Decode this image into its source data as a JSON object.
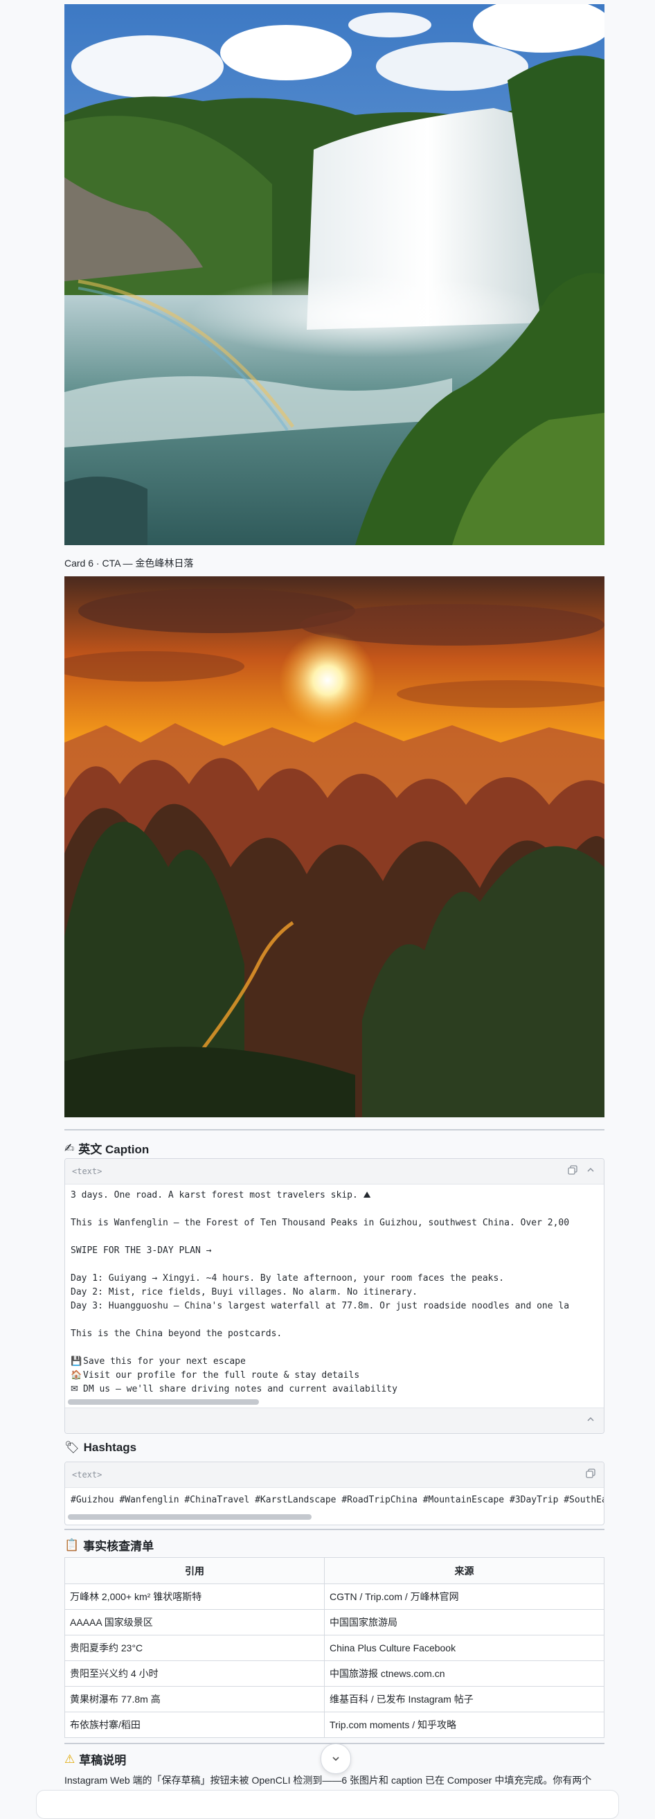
{
  "image_caption": "Card 6 · CTA — 金色峰林日落",
  "caption_section": {
    "icon": "writing-hand-icon",
    "title": "英文 Caption",
    "lang": "<text>",
    "lines": [
      {
        "icon": "",
        "text": "3 days. One road. A karst forest most travelers skip. ⛰"
      },
      {
        "icon": "",
        "text": ""
      },
      {
        "icon": "",
        "text": "This is Wanfenglin — the Forest of Ten Thousand Peaks in Guizhou, southwest China. Over 2,00"
      },
      {
        "icon": "",
        "text": ""
      },
      {
        "icon": "",
        "text": "SWIPE FOR THE 3-DAY PLAN →"
      },
      {
        "icon": "",
        "text": ""
      },
      {
        "icon": "",
        "text": "Day 1: Guiyang → Xingyi. ~4 hours. By late afternoon, your room faces the peaks."
      },
      {
        "icon": "",
        "text": "Day 2: Mist, rice fields, Buyi villages. No alarm. No itinerary."
      },
      {
        "icon": "",
        "text": "Day 3: Huangguoshu — China's largest waterfall at 77.8m. Or just roadside noodles and one la"
      },
      {
        "icon": "",
        "text": ""
      },
      {
        "icon": "",
        "text": "This is the China beyond the postcards."
      },
      {
        "icon": "",
        "text": ""
      },
      {
        "icon": "💾",
        "text": "Save this for your next escape"
      },
      {
        "icon": "🏠",
        "text": "Visit our profile for the full route & stay details"
      },
      {
        "icon": "✉",
        "text": "DM us — we'll share driving notes and current availability"
      }
    ]
  },
  "hashtags_section": {
    "icon": "label-tag-icon",
    "title": "Hashtags",
    "lang": "<text>",
    "text": "#Guizhou #Wanfenglin #ChinaTravel #KarstLandscape #RoadTripChina #MountainEscape #3DayTrip #SouthEa"
  },
  "fact_check": {
    "icon": "clipboard-icon",
    "title": "事实核查清单",
    "headers": [
      "引用",
      "来源"
    ],
    "rows": [
      [
        "万峰林 2,000+ km² 锥状喀斯特",
        "CGTN / Trip.com / 万峰林官网"
      ],
      [
        "AAAAA 国家级景区",
        "中国国家旅游局"
      ],
      [
        "贵阳夏季约 23°C",
        "China Plus Culture Facebook"
      ],
      [
        "贵阳至兴义约 4 小时",
        "中国旅游报 ctnews.com.cn"
      ],
      [
        "黄果树瀑布 77.8m 高",
        "维基百科 / 已发布 Instagram 帖子"
      ],
      [
        "布依族村寨/稻田",
        "Trip.com moments / 知乎攻略"
      ]
    ]
  },
  "draft_note": {
    "icon": "warning-icon",
    "title": "草稿说明",
    "text": "Instagram Web 端的「保存草稿」按钮未被 OpenCLI 检测到——6 张图片和 caption 已在 Composer 中填充完成。你有两个"
  },
  "colors": {
    "background": "#f8f9fb",
    "border": "#d5d9e0",
    "panel_header": "#f3f4f6"
  }
}
